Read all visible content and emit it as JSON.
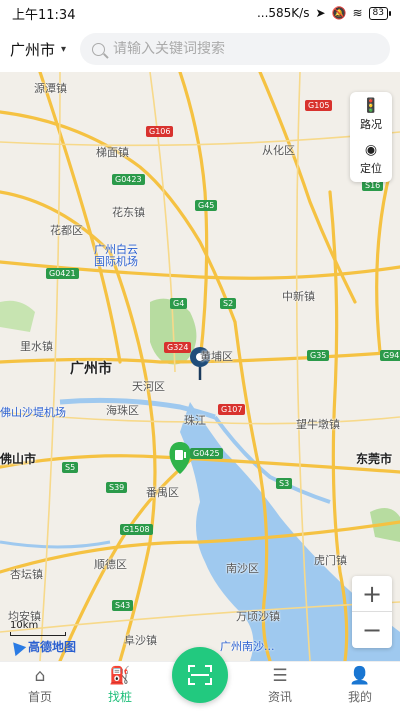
{
  "status_bar": {
    "time": "上午11:34",
    "net_speed": "...585K/s",
    "battery": "83"
  },
  "header": {
    "city": "广州市",
    "search_placeholder": "请输入关键词搜索"
  },
  "map_tools": {
    "traffic_label": "路况",
    "locate_label": "定位"
  },
  "zoom": {
    "in_label": "+",
    "out_label": "−"
  },
  "scale_label": "10km",
  "map_provider": "高德地图",
  "map_labels": {
    "yuanxi": "源潭镇",
    "timian": "梯面镇",
    "conghua": "从化区",
    "huadong": "花东镇",
    "huadu": "花都区",
    "airport": "广州白云\n国际机场",
    "zhongxin": "中新镇",
    "lishui": "里水镇",
    "guangzhou": "广州市",
    "huangpu": "黄埔区",
    "tianhe": "天河区",
    "haizhu": "海珠区",
    "foshan_airport": "佛山沙堤机场",
    "foshan": "佛山市",
    "zhujiang": "珠江",
    "wangniudun": "望牛墩镇",
    "dongguan": "东莞市",
    "panyu": "番禺区",
    "shunde": "顺德区",
    "nansha": "南沙区",
    "humen": "虎门镇",
    "xingtan": "杏坛镇",
    "junan": "均安镇",
    "fusha": "阜沙镇",
    "wanqing": "万顷沙镇",
    "nansha_port": "广州南沙..."
  },
  "road_shields": {
    "g105": "G105",
    "g106": "G106",
    "g0423": "G0423",
    "g45": "G45",
    "s16": "S16",
    "g0421": "G0421",
    "g4": "G4",
    "s2": "S2",
    "g324": "G324",
    "g35": "G35",
    "g94": "G94",
    "g107": "G107",
    "g0425": "G0425",
    "s5": "S5",
    "s39": "S39",
    "s3": "S3",
    "g1508": "G1508",
    "s43": "S43"
  },
  "tabs": {
    "home": "首页",
    "find_pile": "找桩",
    "news": "资讯",
    "mine": "我的"
  }
}
